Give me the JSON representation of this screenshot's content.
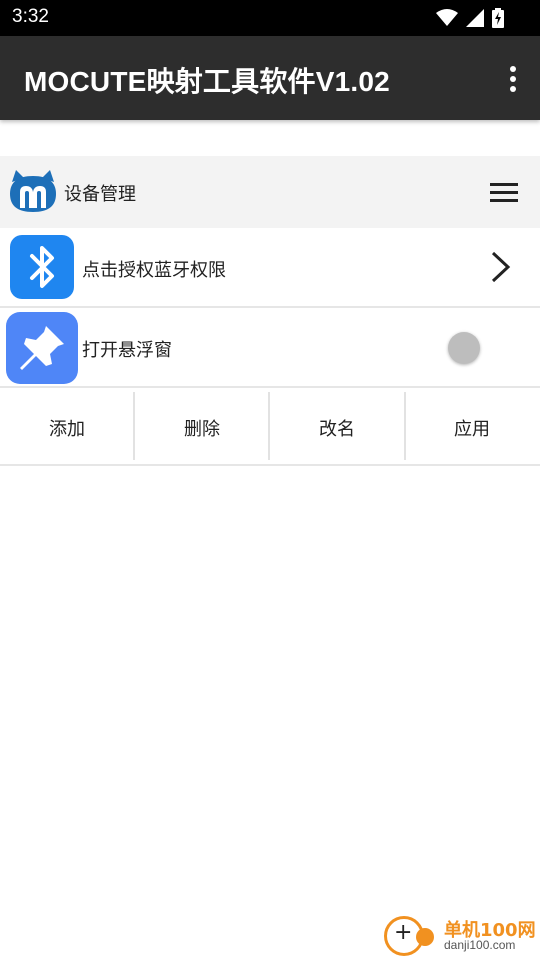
{
  "status_bar": {
    "time": "3:32"
  },
  "app_bar": {
    "title": "MOCUTE映射工具软件V1.02"
  },
  "device_header": {
    "title": "设备管理"
  },
  "rows": {
    "bluetooth_label": "点击授权蓝牙权限",
    "floating_label": "打开悬浮窗"
  },
  "actions": {
    "add": "添加",
    "delete": "删除",
    "rename": "改名",
    "apply": "应用"
  },
  "watermark": {
    "name": "单机100网",
    "domain": "danji100.com"
  },
  "colors": {
    "status_bar_bg": "#000000",
    "app_bar_bg": "#2d2d2d",
    "header_bg": "#f3f3f3",
    "bluetooth_icon": "#1f86f0",
    "pin_icon": "#4f86f7",
    "toggle_off": "#bdbdbd",
    "watermark_accent": "#f19120"
  },
  "icons": {
    "wifi": "wifi-icon",
    "signal": "signal-icon",
    "battery": "battery-charging-icon",
    "overflow": "more-vert-icon",
    "logo": "mocute-logo-icon",
    "menu": "hamburger-menu-icon",
    "bluetooth": "bluetooth-icon",
    "pin": "pushpin-icon",
    "chevron": "chevron-right-icon"
  }
}
